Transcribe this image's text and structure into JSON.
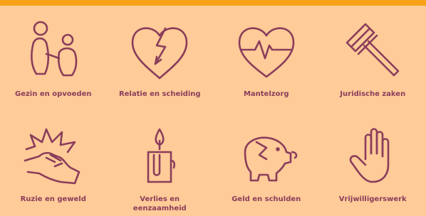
{
  "categories": [
    {
      "label": "Gezin en opvoeden",
      "icon": "family-icon"
    },
    {
      "label": "Relatie en scheiding",
      "icon": "broken-heart-icon"
    },
    {
      "label": "Mantelzorg",
      "icon": "heart-pulse-icon"
    },
    {
      "label": "Juridische zaken",
      "icon": "gavel-icon"
    },
    {
      "label": "Ruzie en geweld",
      "icon": "fist-punch-icon"
    },
    {
      "label": "Verlies en eenzaamheid",
      "icon": "candle-icon"
    },
    {
      "label": "Geld en schulden",
      "icon": "piggy-bank-icon"
    },
    {
      "label": "Vrijwilligerswerk",
      "icon": "raised-hand-icon"
    }
  ],
  "colors": {
    "background": "#ffcb98",
    "accent_bar": "#f7a21b",
    "icon": "#8a3d5b"
  }
}
